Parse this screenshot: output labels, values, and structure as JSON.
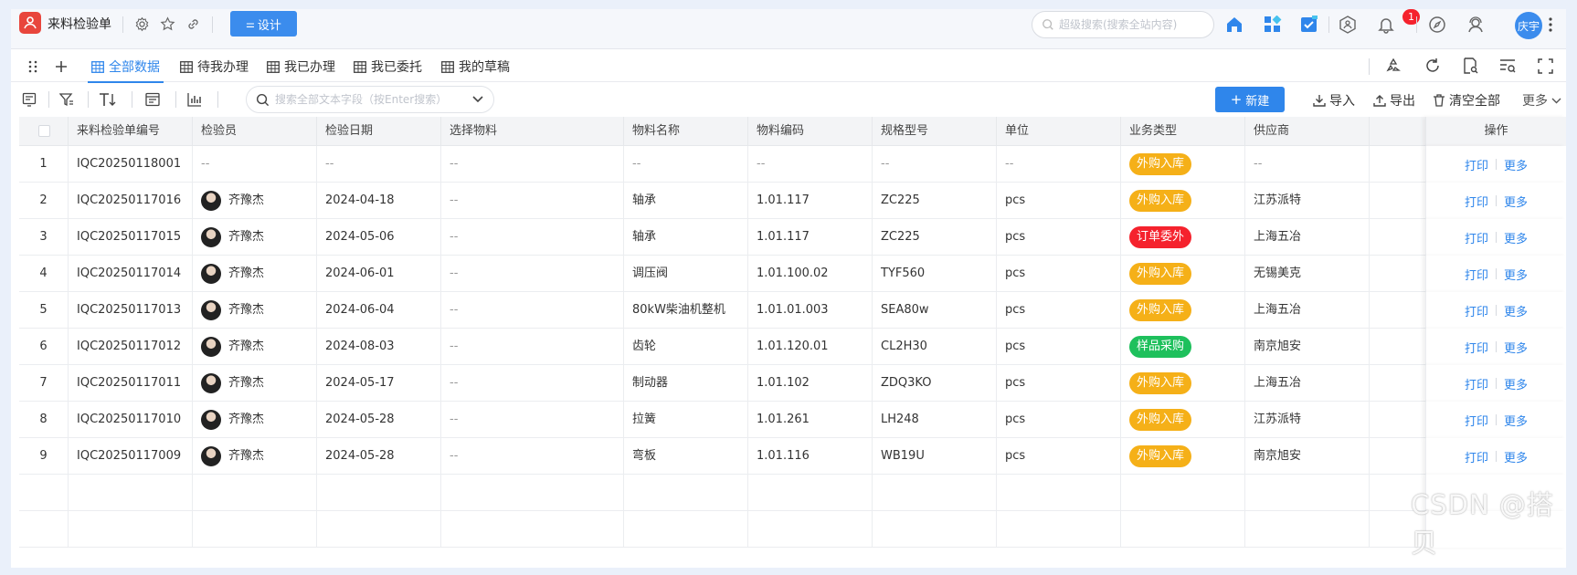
{
  "app": {
    "title": "来料检验单",
    "design_label": "设计"
  },
  "topbar": {
    "search_placeholder": "超级搜索(搜索全站内容)",
    "notification_count": "1",
    "user_avatar_text": "庆宇"
  },
  "tabs": [
    {
      "label": "全部数据",
      "active": true
    },
    {
      "label": "待我办理"
    },
    {
      "label": "我已办理"
    },
    {
      "label": "我已委托"
    },
    {
      "label": "我的草稿"
    }
  ],
  "toolbar": {
    "field_search_placeholder": "搜索全部文本字段（按Enter搜索）",
    "new_label": "新建",
    "import_label": "导入",
    "export_label": "导出",
    "clear_label": "清空全部",
    "more_label": "更多"
  },
  "colors": {
    "accent": "#2f86eb",
    "tag_orange": "#f5b018",
    "tag_red": "#f5222d",
    "tag_green": "#1ec05c"
  },
  "table": {
    "headers": [
      "来料检验单编号",
      "检验员",
      "检验日期",
      "选择物料",
      "物料名称",
      "物料编码",
      "规格型号",
      "单位",
      "业务类型",
      "供应商",
      "操作"
    ],
    "ops": {
      "print": "打印",
      "more": "更多"
    },
    "rows": [
      {
        "index": "1",
        "code": "IQC20250118001",
        "inspector": "--",
        "date": "--",
        "material_sel": "--",
        "material_name": "--",
        "material_code": "--",
        "spec": "--",
        "unit": "--",
        "type": "外购入库",
        "type_color": "orange",
        "supplier": "--"
      },
      {
        "index": "2",
        "code": "IQC20250117016",
        "inspector": "齐豫杰",
        "date": "2024-04-18",
        "material_sel": "--",
        "material_name": "轴承",
        "material_code": "1.01.117",
        "spec": "ZC225",
        "unit": "pcs",
        "type": "外购入库",
        "type_color": "orange",
        "supplier": "江苏派特"
      },
      {
        "index": "3",
        "code": "IQC20250117015",
        "inspector": "齐豫杰",
        "date": "2024-05-06",
        "material_sel": "--",
        "material_name": "轴承",
        "material_code": "1.01.117",
        "spec": "ZC225",
        "unit": "pcs",
        "type": "订单委外",
        "type_color": "red",
        "supplier": "上海五冶"
      },
      {
        "index": "4",
        "code": "IQC20250117014",
        "inspector": "齐豫杰",
        "date": "2024-06-01",
        "material_sel": "--",
        "material_name": "调压阀",
        "material_code": "1.01.100.02",
        "spec": "TYF560",
        "unit": "pcs",
        "type": "外购入库",
        "type_color": "orange",
        "supplier": "无锡美克"
      },
      {
        "index": "5",
        "code": "IQC20250117013",
        "inspector": "齐豫杰",
        "date": "2024-06-04",
        "material_sel": "--",
        "material_name": "80kW柴油机整机",
        "material_code": "1.01.01.003",
        "spec": "SEA80w",
        "unit": "pcs",
        "type": "外购入库",
        "type_color": "orange",
        "supplier": "上海五冶"
      },
      {
        "index": "6",
        "code": "IQC20250117012",
        "inspector": "齐豫杰",
        "date": "2024-08-03",
        "material_sel": "--",
        "material_name": "齿轮",
        "material_code": "1.01.120.01",
        "spec": "CL2H30",
        "unit": "pcs",
        "type": "样品采购",
        "type_color": "green",
        "supplier": "南京旭安"
      },
      {
        "index": "7",
        "code": "IQC20250117011",
        "inspector": "齐豫杰",
        "date": "2024-05-17",
        "material_sel": "--",
        "material_name": "制动器",
        "material_code": "1.01.102",
        "spec": "ZDQ3KO",
        "unit": "pcs",
        "type": "外购入库",
        "type_color": "orange",
        "supplier": "上海五冶"
      },
      {
        "index": "8",
        "code": "IQC20250117010",
        "inspector": "齐豫杰",
        "date": "2024-05-28",
        "material_sel": "--",
        "material_name": "拉簧",
        "material_code": "1.01.261",
        "spec": "LH248",
        "unit": "pcs",
        "type": "外购入库",
        "type_color": "orange",
        "supplier": "江苏派特"
      },
      {
        "index": "9",
        "code": "IQC20250117009",
        "inspector": "齐豫杰",
        "date": "2024-05-28",
        "material_sel": "--",
        "material_name": "弯板",
        "material_code": "1.01.116",
        "spec": "WB19U",
        "unit": "pcs",
        "type": "外购入库",
        "type_color": "orange",
        "supplier": "南京旭安"
      }
    ]
  },
  "watermark": "CSDN @搭贝"
}
